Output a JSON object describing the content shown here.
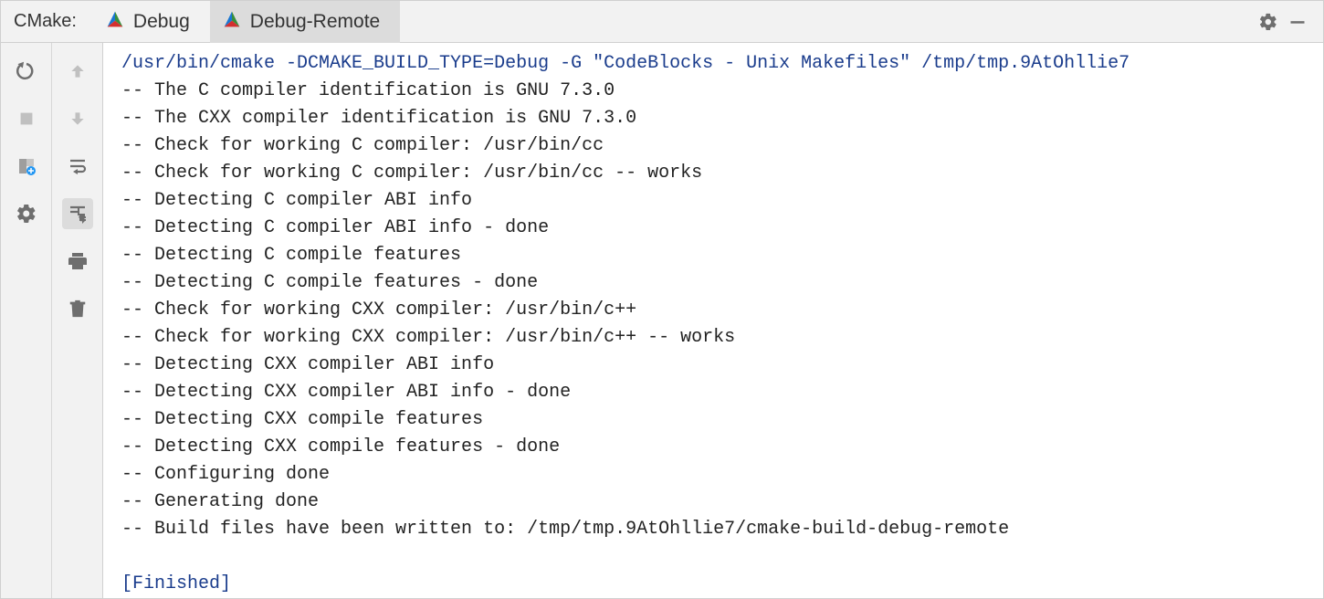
{
  "header": {
    "title": "CMake:",
    "tabs": [
      {
        "label": "Debug",
        "active": false
      },
      {
        "label": "Debug-Remote",
        "active": true
      }
    ]
  },
  "console": {
    "command": "/usr/bin/cmake -DCMAKE_BUILD_TYPE=Debug -G \"CodeBlocks - Unix Makefiles\" /tmp/tmp.9AtOhllie7",
    "lines": [
      "-- The C compiler identification is GNU 7.3.0",
      "-- The CXX compiler identification is GNU 7.3.0",
      "-- Check for working C compiler: /usr/bin/cc",
      "-- Check for working C compiler: /usr/bin/cc -- works",
      "-- Detecting C compiler ABI info",
      "-- Detecting C compiler ABI info - done",
      "-- Detecting C compile features",
      "-- Detecting C compile features - done",
      "-- Check for working CXX compiler: /usr/bin/c++",
      "-- Check for working CXX compiler: /usr/bin/c++ -- works",
      "-- Detecting CXX compiler ABI info",
      "-- Detecting CXX compiler ABI info - done",
      "-- Detecting CXX compile features",
      "-- Detecting CXX compile features - done",
      "-- Configuring done",
      "-- Generating done",
      "-- Build files have been written to: /tmp/tmp.9AtOhllie7/cmake-build-debug-remote"
    ],
    "finished": "[Finished]"
  }
}
